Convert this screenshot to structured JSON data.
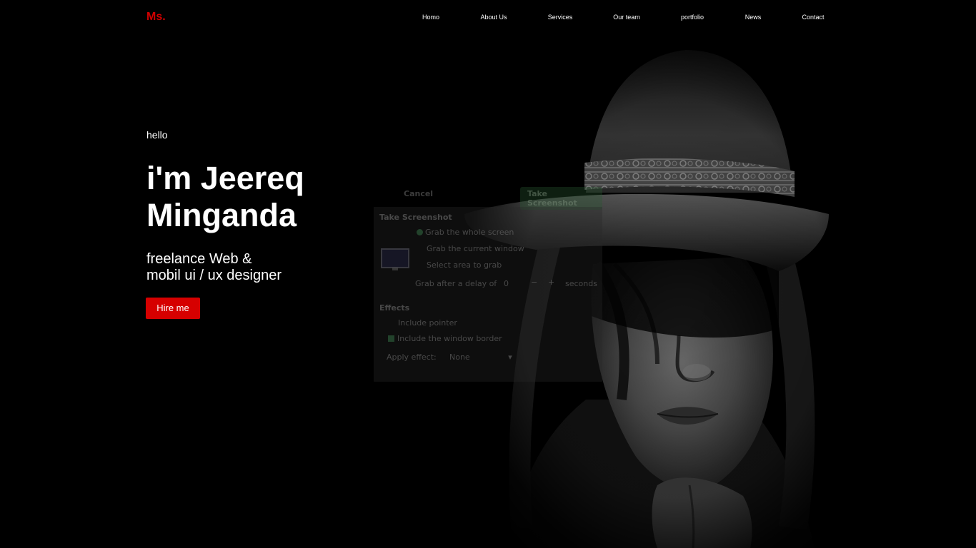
{
  "header": {
    "logo": "Ms.",
    "nav": [
      {
        "label": "Homo"
      },
      {
        "label": "About Us"
      },
      {
        "label": "Services"
      },
      {
        "label": "Our team"
      },
      {
        "label": "portfolio"
      },
      {
        "label": "News"
      },
      {
        "label": "Contact"
      }
    ]
  },
  "hero": {
    "greeting": "hello",
    "title_line1": "i'm Jeereq",
    "title_line2": "Minganda",
    "subtitle_line1": "freelance Web &",
    "subtitle_line2": "mobil ui / ux designer",
    "cta_label": "Hire me"
  },
  "screenshot_dialog": {
    "cancel_label": "Cancel",
    "take_label": "Take Screenshot",
    "section_title": "Take Screenshot",
    "option_whole": "Grab the whole screen",
    "option_window": "Grab the current window",
    "option_area": "Select area to grab",
    "delay_label": "Grab after a delay of",
    "delay_value": "0",
    "delay_unit": "seconds",
    "effects_title": "Effects",
    "include_pointer": "Include pointer",
    "include_border": "Include the window border",
    "apply_effect_label": "Apply effect:",
    "apply_effect_value": "None"
  },
  "colors": {
    "accent": "#d60000",
    "background": "#000000",
    "text": "#ffffff"
  }
}
